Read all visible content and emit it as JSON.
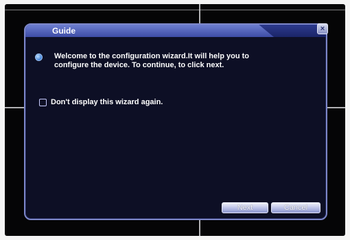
{
  "dialog": {
    "title": "Guide",
    "close_icon": "close-icon",
    "message": "Welcome to the configuration wizard.It will help you to configure the device. To continue, to click next.",
    "checkbox_label": "Don't display this wizard again.",
    "checkbox_checked": false,
    "next_label": "Next",
    "cancel_label": "Cancel"
  },
  "colors": {
    "title_bar": "#3d4ca6",
    "dialog_bg": "#0d0f25",
    "border": "#7d87c9"
  }
}
